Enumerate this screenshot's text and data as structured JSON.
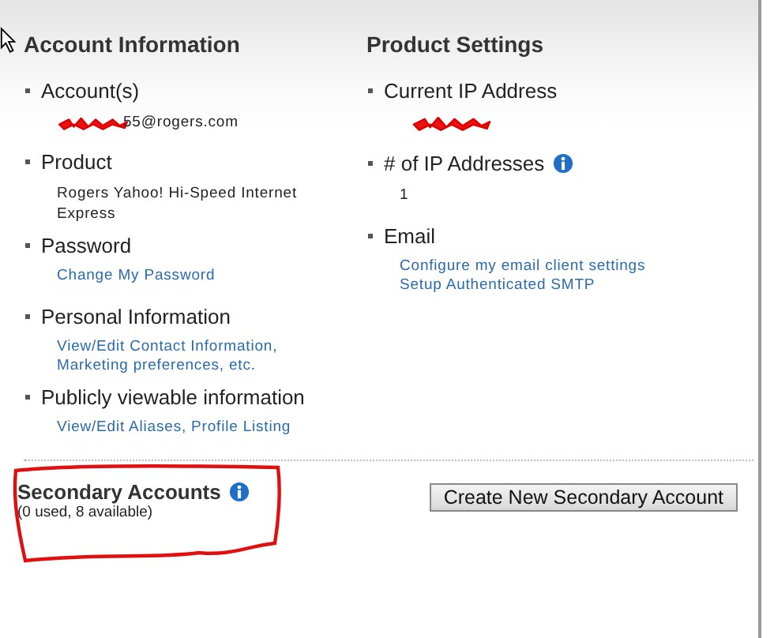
{
  "sections": [
    {
      "title": "Account Information",
      "items": [
        {
          "label": "Account(s)",
          "info": false,
          "details": [
            {
              "kind": "redacted",
              "text": "55@rogers.com"
            }
          ]
        },
        {
          "label": "Product",
          "info": false,
          "details": [
            {
              "kind": "text",
              "text": "Rogers Yahoo! Hi-Speed Internet Express"
            }
          ]
        },
        {
          "label": "Password",
          "info": false,
          "details": [
            {
              "kind": "link",
              "text": "Change My Password"
            }
          ]
        },
        {
          "label": "Personal Information",
          "info": false,
          "details": [
            {
              "kind": "link",
              "text": "View/Edit Contact Information, Marketing preferences, etc."
            }
          ]
        },
        {
          "label": "Publicly viewable information",
          "info": false,
          "details": [
            {
              "kind": "link",
              "text": "View/Edit Aliases, Profile Listing"
            }
          ]
        }
      ]
    },
    {
      "title": "Product Settings",
      "items": [
        {
          "label": "Current IP Address",
          "info": false,
          "details": [
            {
              "kind": "scribble"
            }
          ]
        },
        {
          "label": "# of IP Addresses",
          "info": true,
          "details": [
            {
              "kind": "text",
              "text": "1"
            }
          ]
        },
        {
          "label": "Email",
          "info": false,
          "details": [
            {
              "kind": "link",
              "text": "Configure my email client settings"
            },
            {
              "kind": "link",
              "text": "Setup Authenticated SMTP"
            }
          ]
        }
      ]
    }
  ],
  "secondary": {
    "title": "Secondary Accounts",
    "info": true,
    "note": "(0 used, 8 available)",
    "button": "Create New Secondary Account"
  }
}
